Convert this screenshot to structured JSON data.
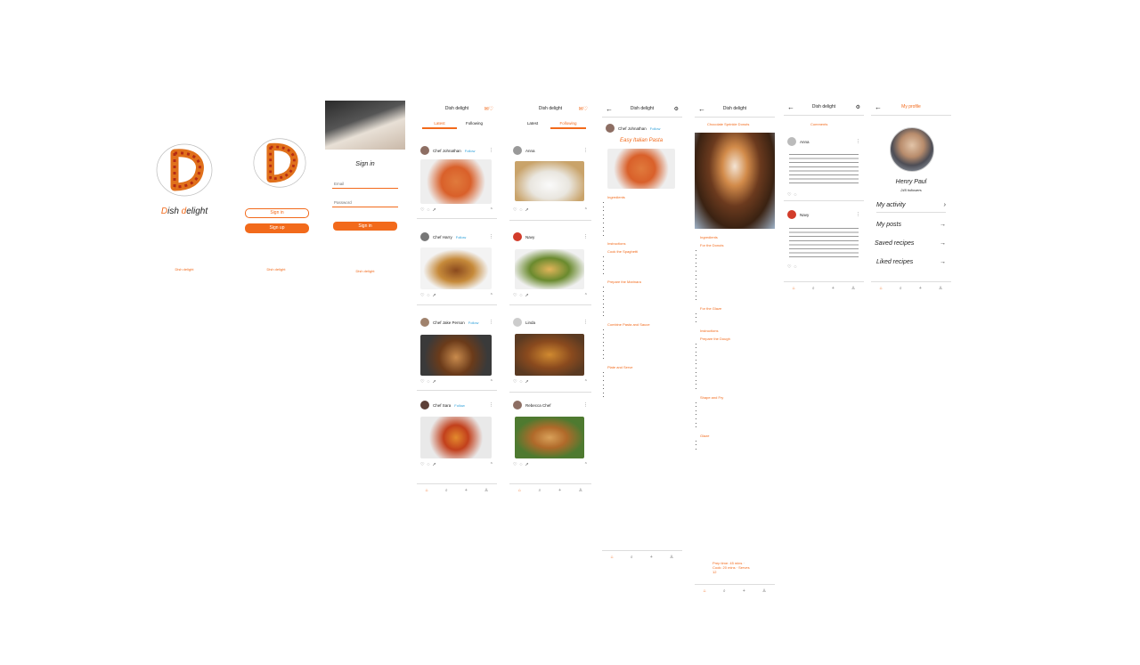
{
  "brand": {
    "name_prefix": "D",
    "name_mid": "ish ",
    "name_d": "d",
    "name_rest": "elight",
    "accent": "#f26a1b"
  },
  "splash": {
    "footer": "Dish delight"
  },
  "welcome": {
    "signin_label": "Sign in",
    "signup_label": "Sign up",
    "footer": "Dish delight"
  },
  "signin": {
    "title": "Sign in",
    "email_placeholder": "Email",
    "password_placeholder": "Password",
    "signin_label": "Sign in",
    "footer": "Dish delight"
  },
  "feed": {
    "title": "Dish delight",
    "tabs": [
      "Latest",
      "Following"
    ],
    "posts": [
      {
        "user": "Chef Johnathan",
        "follow": "Follow"
      },
      {
        "user": "Chef Harry",
        "follow": "Follow"
      },
      {
        "user": "Chef Jake Person",
        "follow": "Follow"
      },
      {
        "user": "Chef Sara",
        "follow": "Follow"
      }
    ]
  },
  "feed2": {
    "title": "Dish delight",
    "tabs": [
      "Latest",
      "Following"
    ],
    "posts": [
      {
        "user": "Anna"
      },
      {
        "user": "Navy"
      },
      {
        "user": "Linda"
      },
      {
        "user": "Rebecca Chef"
      }
    ]
  },
  "recipe": {
    "header": "Dish delight",
    "author": "Chef Johnathan",
    "follow": "Follow",
    "title": "Easy Italian Pasta",
    "sections": [
      "Ingredients",
      "Instructions",
      "Cook the Spaghetti",
      "Prepare the Marinara",
      "Combine Pasta and Sauce",
      "Plate and Serve"
    ]
  },
  "donut": {
    "header": "Dish delight",
    "subtitle": "Chocolate Sprinkle Donuts",
    "sections": [
      "Ingredients",
      "For the Donuts",
      "For the Glaze",
      "Instructions",
      "Prepare the Dough",
      "Shape and Fry",
      "Glaze",
      "Serve"
    ],
    "note": "Prep time: 45 mins · Cook: 20 mins · Serves 12"
  },
  "comments": {
    "header": "Dish delight",
    "subtitle": "Comments",
    "items": [
      {
        "user": "Anna"
      },
      {
        "user": "Navy"
      }
    ]
  },
  "profile": {
    "header": "My profile",
    "name": "Henry Paul",
    "followers": "245 followers",
    "menu": [
      {
        "label": "My activity",
        "arrow": "›"
      },
      {
        "label": "My posts",
        "arrow": "→"
      },
      {
        "label": "Saved recipes",
        "arrow": "→"
      },
      {
        "label": "Liked recipes",
        "arrow": "→"
      }
    ]
  },
  "nav": {
    "home": "⌂",
    "search": "⌕",
    "add": "+",
    "profile": "♙"
  }
}
